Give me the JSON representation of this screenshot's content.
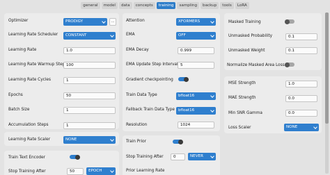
{
  "tabs": [
    {
      "label": "general"
    },
    {
      "label": "model"
    },
    {
      "label": "data"
    },
    {
      "label": "concepts"
    },
    {
      "label": "training",
      "active": true
    },
    {
      "label": "sampling"
    },
    {
      "label": "backup"
    },
    {
      "label": "tools"
    },
    {
      "label": "LoRA"
    }
  ],
  "left": {
    "optimizer_label": "Optimizer",
    "optimizer_value": "PRODIGY",
    "optimizer_more": "...",
    "lr_scheduler_label": "Learning Rate Scheduler",
    "lr_scheduler_value": "CONSTANT",
    "lr_label": "Learning Rate",
    "lr_value": "1.0",
    "warmup_label": "Learning Rate Warmup Steps",
    "warmup_value": "100",
    "cycles_label": "Learning Rate Cycles",
    "cycles_value": "1",
    "epochs_label": "Epochs",
    "epochs_value": "50",
    "batch_label": "Batch Size",
    "batch_value": "1",
    "accum_label": "Accumulation Steps",
    "accum_value": "1",
    "lr_scaler_label": "Learning Rate Scaler",
    "lr_scaler_value": "NONE",
    "train_te_label": "Train Text Encoder",
    "train_te_on": true,
    "stop_after_label": "Stop Training After",
    "stop_after_value": "50",
    "stop_after_unit": "EPOCH"
  },
  "middle": {
    "attention_label": "Attention",
    "attention_value": "XFORMERS",
    "ema_label": "EMA",
    "ema_value": "OFF",
    "ema_decay_label": "EMA Decay",
    "ema_decay_value": "0.999",
    "ema_interval_label": "EMA Update Step Interval",
    "ema_interval_value": "5",
    "grad_ckpt_label": "Gradient checkpointing",
    "grad_ckpt_on": true,
    "train_dtype_label": "Train Data Type",
    "train_dtype_value": "bfloat16",
    "fallback_dtype_label": "Fallback Train Data Type",
    "fallback_dtype_value": "bfloat16",
    "resolution_label": "Resolution",
    "resolution_value": "1024",
    "train_prior_label": "Train Prior",
    "train_prior_on": true,
    "stop_after_label": "Stop Training After",
    "stop_after_value": "0",
    "stop_after_unit": "NEVER",
    "prior_lr_label": "Prior Learning Rate"
  },
  "right": {
    "masked_label": "Masked Training",
    "masked_on": false,
    "unmasked_prob_label": "Unmasked Probability",
    "unmasked_prob_value": "0.1",
    "unmasked_weight_label": "Unmasked Weight",
    "unmasked_weight_value": "0.1",
    "normalize_label": "Normalize Masked Area Loss",
    "normalize_on": false,
    "mse_label": "MSE Strength",
    "mse_value": "1.0",
    "mae_label": "MAE Strength",
    "mae_value": "0.0",
    "snr_label": "Min SNR Gamma",
    "snr_value": "0.0",
    "loss_scaler_label": "Loss Scaler",
    "loss_scaler_value": "NONE"
  },
  "colors": {
    "accent": "#2f7fce",
    "panel": "#ececec",
    "background": "#e3e3e3"
  }
}
